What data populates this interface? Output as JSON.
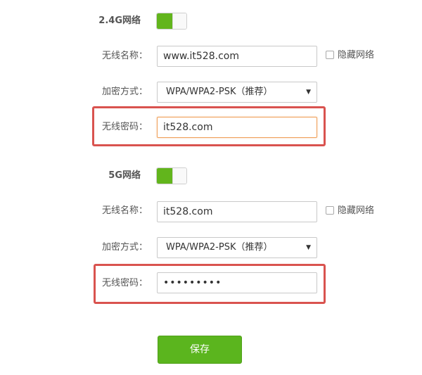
{
  "band_24": {
    "title": "2.4G网络",
    "enabled": true,
    "ssid_label": "无线名称：",
    "ssid_value": "www.it528.com",
    "hide_label": "隐藏网络",
    "hide_checked": false,
    "security_label": "加密方式：",
    "security_value": "WPA/WPA2-PSK（推荐）",
    "password_label": "无线密码：",
    "password_value": "it528.com"
  },
  "band_5": {
    "title": "5G网络",
    "enabled": true,
    "ssid_label": "无线名称：",
    "ssid_value": "it528.com",
    "hide_label": "隐藏网络",
    "hide_checked": false,
    "security_label": "加密方式：",
    "security_value": "WPA/WPA2-PSK（推荐）",
    "password_label": "无线密码：",
    "password_value": "•••••••••"
  },
  "save_label": "保存",
  "colors": {
    "toggle_on": "#62b51c",
    "highlight": "#d9534f",
    "save_button": "#5bb51e",
    "focus_border": "#f0a05a"
  }
}
